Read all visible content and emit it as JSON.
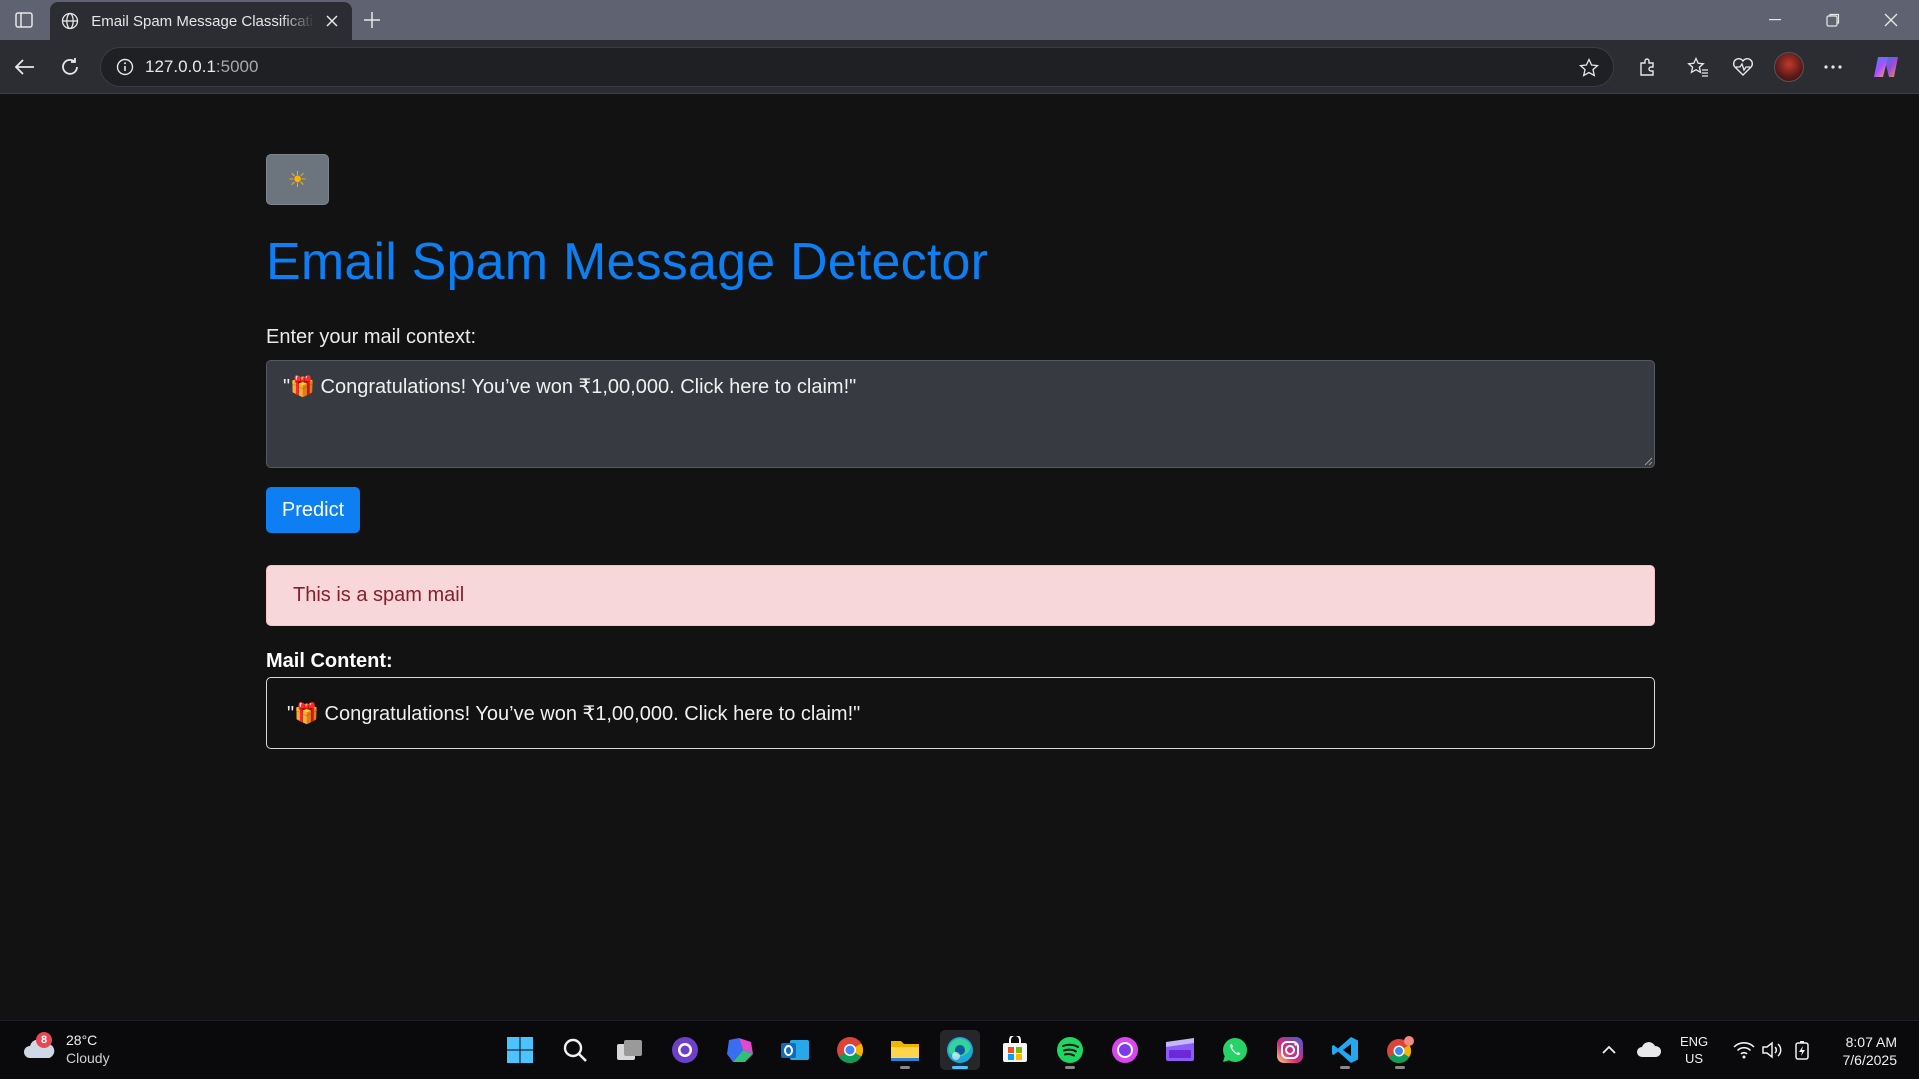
{
  "browser": {
    "tab_title": "Email Spam Message Classification",
    "url_host": "127.0.0.1",
    "url_port": ":5000"
  },
  "page": {
    "theme_toggle_icon": "☀",
    "title": "Email Spam Message Detector",
    "input_label": "Enter your mail context:",
    "input_value": "\"🎁 Congratulations! You’ve won ₹1,00,000. Click here to claim!\"",
    "predict_label": "Predict",
    "result_text": "This is a spam mail",
    "mail_content_label": "Mail Content:",
    "mail_content_value": "\"🎁 Congratulations! You’ve won ₹1,00,000. Click here to claim!\""
  },
  "taskbar": {
    "weather_badge": "8",
    "weather_temp": "28°C",
    "weather_condition": "Cloudy",
    "lang_line1": "ENG",
    "lang_line2": "US",
    "time": "8:07 AM",
    "date": "7/6/2025"
  },
  "colors": {
    "accent": "#0d7ff2",
    "alert_bg": "#f8d7da",
    "alert_text": "#842029"
  }
}
